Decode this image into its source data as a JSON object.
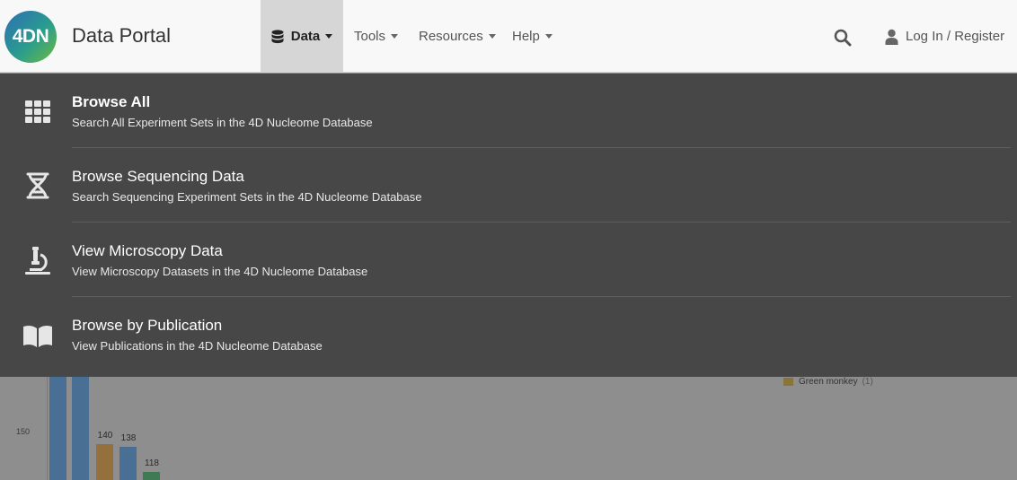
{
  "brand": {
    "logo_text": "4DN",
    "title": "Data Portal"
  },
  "nav": {
    "data_label": "Data",
    "tools_label": "Tools",
    "resources_label": "Resources",
    "help_label": "Help",
    "login_label": "Log In / Register"
  },
  "dropdown": {
    "items": [
      {
        "title": "Browse All",
        "desc": "Search All Experiment Sets in the 4D Nucleome Database",
        "icon": "grid-icon"
      },
      {
        "title": "Browse Sequencing Data",
        "desc": "Search Sequencing Experiment Sets in the 4D Nucleome Database",
        "icon": "dna-icon"
      },
      {
        "title": "View Microscopy Data",
        "desc": "View Microscopy Datasets in the 4D Nucleome Database",
        "icon": "microscope-icon"
      },
      {
        "title": "Browse by Publication",
        "desc": "View Publications in the 4D Nucleome Database",
        "icon": "book-icon"
      }
    ]
  },
  "chart_data": {
    "type": "bar",
    "y_tick": "150",
    "bars": [
      {
        "label": "",
        "value": null,
        "color": "#4a6f95"
      },
      {
        "label": "",
        "value": null,
        "color": "#4a6f95"
      },
      {
        "label": "140",
        "value": 140,
        "color": "#93703c"
      },
      {
        "label": "138",
        "value": 138,
        "color": "#4a6f95"
      },
      {
        "label": "118",
        "value": 118,
        "color": "#3f7a55"
      }
    ],
    "legend": [
      {
        "name": "Green monkey",
        "count": "(1)",
        "color": "#8a7437"
      }
    ]
  }
}
